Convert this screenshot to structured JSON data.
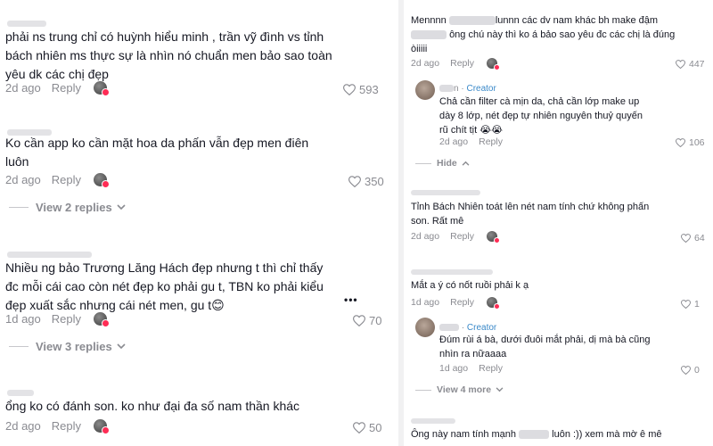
{
  "left": {
    "comments": [
      {
        "text": "phải ns trung chỉ có huỳnh hiểu minh , trần vỹ đình vs tỉnh bách nhiên ms thực sự là nhìn nó chuẩn men bảo sao toàn yêu dk các chị đẹp",
        "date": "2d ago",
        "reply": "Reply",
        "likes": "593"
      },
      {
        "text": "Ko cần app ko cần mặt hoa da phấn vẫn đẹp men điên luôn",
        "date": "2d ago",
        "reply": "Reply",
        "likes": "350",
        "view_replies": "View 2 replies"
      },
      {
        "text": "Nhiều ng bảo Trương Lăng Hách đẹp nhưng t thì chỉ thấy đc mỗi cái cao còn nét đẹp ko phải gu t, TBN ko phải kiểu đẹp xuất sắc nhưng cái nét men, gu t😊",
        "date": "1d ago",
        "reply": "Reply",
        "likes": "70",
        "more": "•••",
        "view_replies": "View 3 replies"
      },
      {
        "text": "ổng ko có đánh son. ko như đại đa số nam thần khác",
        "date": "2d ago",
        "reply": "Reply",
        "likes": "50"
      }
    ]
  },
  "right": {
    "c1": {
      "text_a": "Mennnn",
      "text_b": "lunnn các dv nam khác bh make đậm",
      "text_c": "ông chú này thì ko á bảo sao yêu đc các chị là đúng",
      "text_d": "òiiiii",
      "date": "2d ago",
      "reply": "Reply",
      "likes": "447"
    },
    "r1": {
      "name_tail": "n",
      "dot": "·",
      "creator": "Creator",
      "text": "Chả cần filter cà mịn da, chả cần lớp make up dày 8 lớp, nét đẹp tự nhiên nguyên thuỷ quyến rũ chít tịt 😭😭",
      "date": "2d ago",
      "reply": "Reply",
      "likes": "106",
      "hide": "Hide"
    },
    "c2": {
      "text": "Tỉnh Bách Nhiên toát lên nét nam tính chứ không phấn son. Rất mê",
      "date": "2d ago",
      "reply": "Reply",
      "likes": "64"
    },
    "c3": {
      "text": "Mắt a ý có nốt ruồi phải k ạ",
      "date": "1d ago",
      "reply": "Reply",
      "likes": "1"
    },
    "r3": {
      "dot": "·",
      "creator": "Creator",
      "text": "Đúm rùi á bà, dưới đuôi mắt phải, dị mà bà cũng nhìn ra nữaaaa",
      "date": "1d ago",
      "reply": "Reply",
      "likes": "0",
      "view_more": "View 4 more"
    },
    "c4": {
      "text_a": "Ông này nam tính mạnh",
      "text_b": "luôn :)) xem mà mờ ê mê"
    }
  }
}
